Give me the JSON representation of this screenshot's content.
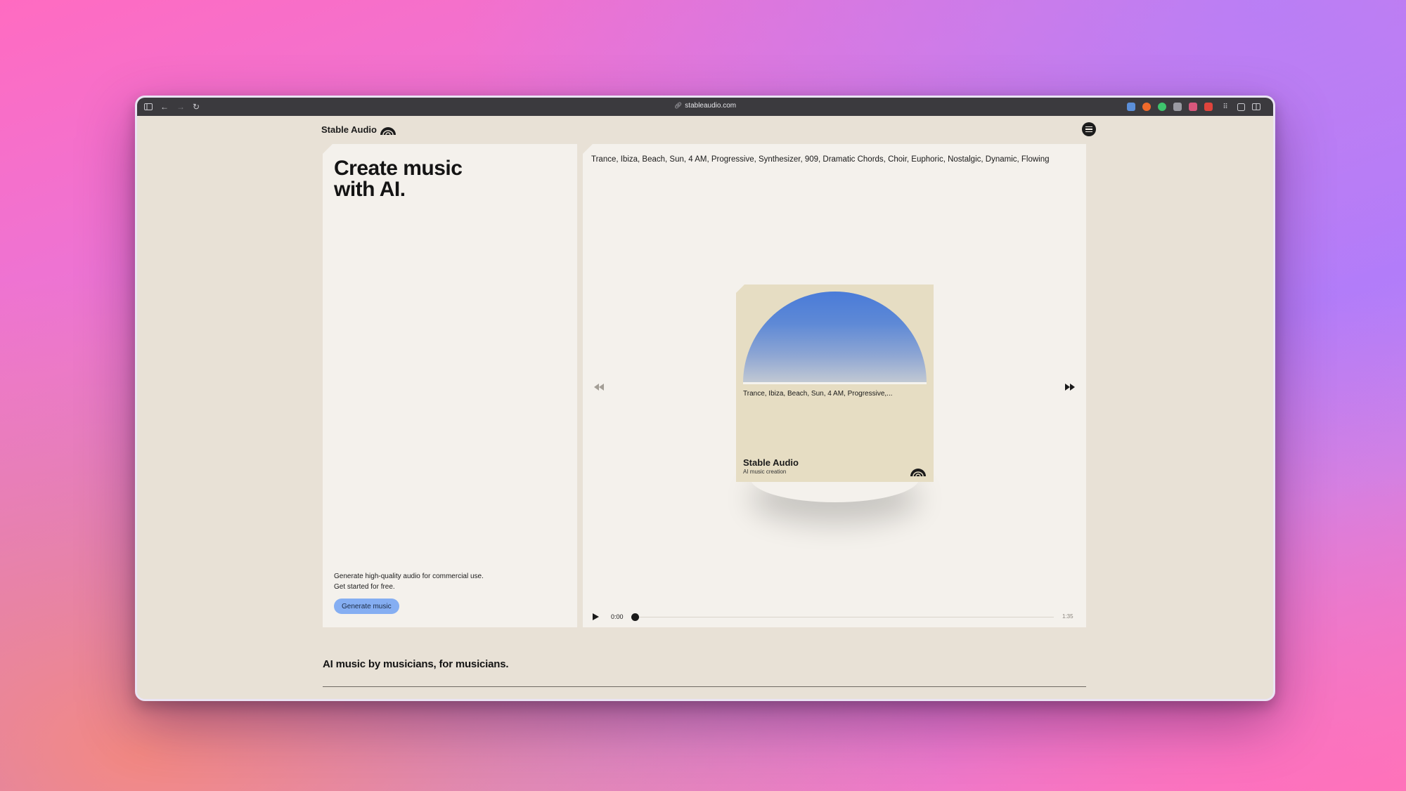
{
  "browser": {
    "url": "stableaudio.com",
    "accent_colors": [
      "#5b8fd9",
      "#f06a2a",
      "#3ec46d",
      "#9a9aa2",
      "#d8577c",
      "#e0443c"
    ]
  },
  "header": {
    "brand": "Stable Audio",
    "menu_icon": "hamburger-menu-icon"
  },
  "hero": {
    "title": "Create music with AI.",
    "subtitle_line1": "Generate high-quality audio for commercial use.",
    "subtitle_line2": "Get started for free.",
    "cta_label": "Generate music",
    "cta_color": "#85aef2"
  },
  "player": {
    "prompt": "Trance, Ibiza, Beach, Sun, 4 AM, Progressive, Synthesizer, 909, Dramatic Chords, Choir, Euphoric, Nostalgic, Dynamic, Flowing",
    "album": {
      "prompt_short": "Trance, Ibiza, Beach, Sun, 4 AM, Progressive,...",
      "title": "Stable Audio",
      "subtitle": "AI music creation",
      "dome_color": "#4a7bd8"
    },
    "current_time": "0:00",
    "total_time": "1:35",
    "progress": 0
  },
  "section": {
    "tagline": "AI music by musicians, for musicians."
  }
}
